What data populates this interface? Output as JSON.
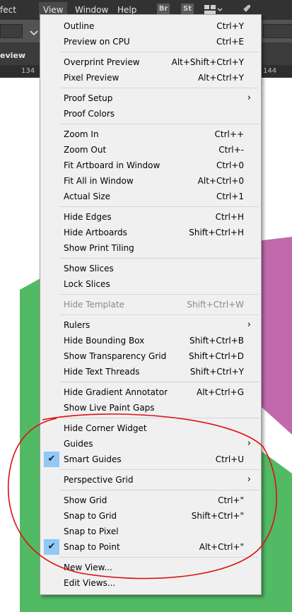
{
  "app": {
    "menubar": {
      "items": [
        "fect",
        "View",
        "Window",
        "Help"
      ],
      "badges": [
        "Br",
        "St"
      ]
    },
    "tab_label": "eview",
    "ruler": {
      "left_label": "134",
      "right_label": "144"
    },
    "brand_colors": {
      "green": "#52b965",
      "purple": "#c06aad",
      "annotation": "#dd1111",
      "check_bg": "#90c8f6"
    }
  },
  "menu": {
    "groups": [
      [
        {
          "label": "Outline",
          "shortcut": "Ctrl+Y"
        },
        {
          "label": "Preview on CPU",
          "shortcut": "Ctrl+E"
        }
      ],
      [
        {
          "label": "Overprint Preview",
          "shortcut": "Alt+Shift+Ctrl+Y"
        },
        {
          "label": "Pixel Preview",
          "shortcut": "Alt+Ctrl+Y"
        }
      ],
      [
        {
          "label": "Proof Setup",
          "shortcut": "",
          "submenu": true
        },
        {
          "label": "Proof Colors",
          "shortcut": ""
        }
      ],
      [
        {
          "label": "Zoom In",
          "shortcut": "Ctrl++"
        },
        {
          "label": "Zoom Out",
          "shortcut": "Ctrl+-"
        },
        {
          "label": "Fit Artboard in Window",
          "shortcut": "Ctrl+0"
        },
        {
          "label": "Fit All in Window",
          "shortcut": "Alt+Ctrl+0"
        },
        {
          "label": "Actual Size",
          "shortcut": "Ctrl+1"
        }
      ],
      [
        {
          "label": "Hide Edges",
          "shortcut": "Ctrl+H"
        },
        {
          "label": "Hide Artboards",
          "shortcut": "Shift+Ctrl+H"
        },
        {
          "label": "Show Print Tiling",
          "shortcut": ""
        }
      ],
      [
        {
          "label": "Show Slices",
          "shortcut": ""
        },
        {
          "label": "Lock Slices",
          "shortcut": ""
        }
      ],
      [
        {
          "label": "Hide Template",
          "shortcut": "Shift+Ctrl+W",
          "disabled": true
        }
      ],
      [
        {
          "label": "Rulers",
          "shortcut": "",
          "submenu": true
        },
        {
          "label": "Hide Bounding Box",
          "shortcut": "Shift+Ctrl+B"
        },
        {
          "label": "Show Transparency Grid",
          "shortcut": "Shift+Ctrl+D"
        },
        {
          "label": "Hide Text Threads",
          "shortcut": "Shift+Ctrl+Y"
        }
      ],
      [
        {
          "label": "Hide Gradient Annotator",
          "shortcut": "Alt+Ctrl+G"
        },
        {
          "label": "Show Live Paint Gaps",
          "shortcut": ""
        }
      ],
      [
        {
          "label": "Hide Corner Widget",
          "shortcut": ""
        },
        {
          "label": "Guides",
          "shortcut": "",
          "submenu": true
        },
        {
          "label": "Smart Guides",
          "shortcut": "Ctrl+U",
          "checked": true
        }
      ],
      [
        {
          "label": "Perspective Grid",
          "shortcut": "",
          "submenu": true
        }
      ],
      [
        {
          "label": "Show Grid",
          "shortcut": "Ctrl+\""
        },
        {
          "label": "Snap to Grid",
          "shortcut": "Shift+Ctrl+\""
        },
        {
          "label": "Snap to Pixel",
          "shortcut": ""
        },
        {
          "label": "Snap to Point",
          "shortcut": "Alt+Ctrl+\"",
          "checked": true
        }
      ],
      [
        {
          "label": "New View...",
          "shortcut": ""
        },
        {
          "label": "Edit Views...",
          "shortcut": ""
        }
      ]
    ]
  }
}
